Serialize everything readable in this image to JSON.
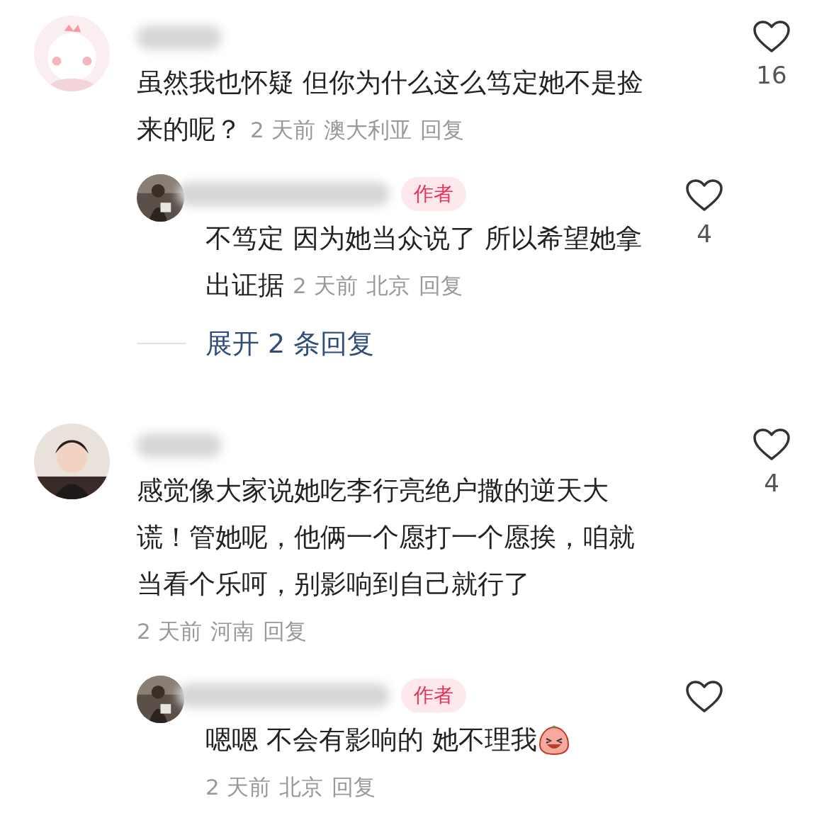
{
  "comments": [
    {
      "lines": [
        "虽然我也怀疑 但你为什么这么笃定她不是捡",
        "来的呢？"
      ],
      "meta_inline": true,
      "time": "2 天前",
      "location": "澳大利亚",
      "reply_label": "回复",
      "likes": "16",
      "liked": false,
      "replies": [
        {
          "badge": "作者",
          "lines": [
            "不笃定 因为她当众说了 所以希望她拿",
            "出证据"
          ],
          "meta_inline": true,
          "time": "2 天前",
          "location": "北京",
          "reply_label": "回复",
          "likes": "4",
          "liked": false
        }
      ],
      "expand_label": "展开 2 条回复"
    },
    {
      "lines": [
        "感觉像大家说她吃李行亮绝户撒的逆天大",
        "谎！管她呢，他俩一个愿打一个愿挨，咱就",
        "当看个乐呵，别影响到自己就行了"
      ],
      "meta_inline": false,
      "time": "2 天前",
      "location": "河南",
      "reply_label": "回复",
      "likes": "4",
      "liked": false,
      "replies": [
        {
          "badge": "作者",
          "lines": [
            "嗯嗯 不会有影响的 她不理我"
          ],
          "meta_inline": false,
          "emoji": true,
          "time": "2 天前",
          "location": "北京",
          "reply_label": "回复",
          "liked": false
        }
      ]
    }
  ]
}
